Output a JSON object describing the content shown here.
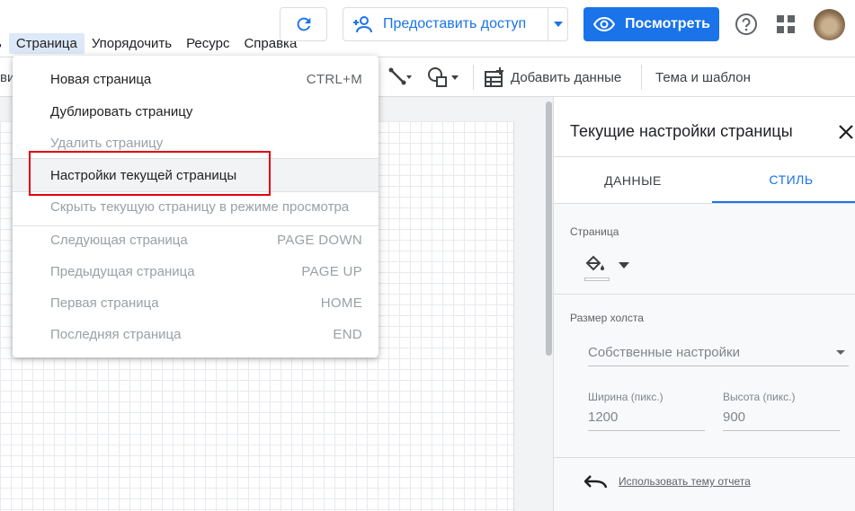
{
  "menubar": {
    "items": [
      {
        "label": "ь",
        "active": false
      },
      {
        "label": "Страница",
        "active": true
      },
      {
        "label": "Упорядочить",
        "active": false
      },
      {
        "label": "Ресурс",
        "active": false
      },
      {
        "label": "Справка",
        "active": false
      }
    ]
  },
  "header": {
    "share_label": "Предоставить доступ",
    "view_label": "Посмотреть",
    "icons": [
      "refresh-icon",
      "add-person-icon",
      "caret-down-icon",
      "eye-icon",
      "help-icon",
      "apps-icon",
      "avatar"
    ]
  },
  "toolbar": {
    "cut_label": "ви",
    "add_data_label": "Добавить данные",
    "theme_label": "Тема и шаблон"
  },
  "dropdown": {
    "items": [
      {
        "label": "Новая страница",
        "shortcut": "CTRL+M",
        "enabled": true
      },
      {
        "label": "Дублировать страницу",
        "shortcut": "",
        "enabled": true
      },
      {
        "label": "Удалить страницу",
        "shortcut": "",
        "enabled": false
      },
      {
        "label": "Настройки текущей страницы",
        "shortcut": "",
        "enabled": true
      },
      {
        "label": "Скрыть текущую страницу в режиме просмотра",
        "shortcut": "",
        "enabled": false
      },
      {
        "label": "Следующая страница",
        "shortcut": "PAGE DOWN",
        "enabled": false
      },
      {
        "label": "Предыдущая страница",
        "shortcut": "PAGE UP",
        "enabled": false
      },
      {
        "label": "Первая страница",
        "shortcut": "HOME",
        "enabled": false
      },
      {
        "label": "Последняя страница",
        "shortcut": "END",
        "enabled": false
      }
    ],
    "highlight_color": "#e3000f"
  },
  "panel": {
    "title": "Текущие настройки страницы",
    "tabs": {
      "data": "ДАННЫЕ",
      "style": "СТИЛЬ"
    },
    "page_section_label": "Страница",
    "canvas_size_label": "Размер холста",
    "canvas_size_value": "Собственные настройки",
    "width_label": "Ширина (пикс.)",
    "width_value": "1200",
    "height_label": "Высота (пикс.)",
    "height_value": "900",
    "use_theme_link": "Использовать тему отчета"
  },
  "colors": {
    "accent": "#1a73e8",
    "menu_active_bg": "#dde8f8"
  }
}
